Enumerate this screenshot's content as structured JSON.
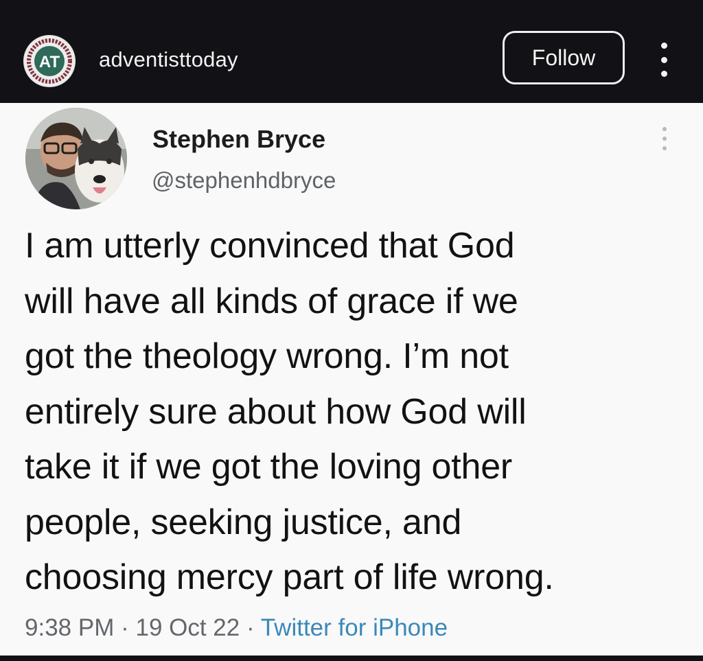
{
  "account_bar": {
    "logo_text": "AT",
    "username": "adventisttoday",
    "follow_label": "Follow",
    "more_icon": "more-vertical-icon"
  },
  "tweet": {
    "display_name": "Stephen Bryce",
    "handle": "@stephenhdbryce",
    "text_lines": [
      "I am utterly convinced that God",
      "will have all kinds of grace if we",
      "got the theology wrong. I’m not",
      "entirely sure about how God will",
      "take it if we got the loving other",
      "people, seeking justice, and",
      "choosing mercy part of life wrong."
    ],
    "time": "9:38 PM",
    "date": "19 Oct 22",
    "separator": "·",
    "source": "Twitter for iPhone"
  },
  "colors": {
    "top_bar": "#121216",
    "card_background": "#f9f9f9",
    "link": "#3a88b9",
    "logo_ring": "#7f3440"
  }
}
